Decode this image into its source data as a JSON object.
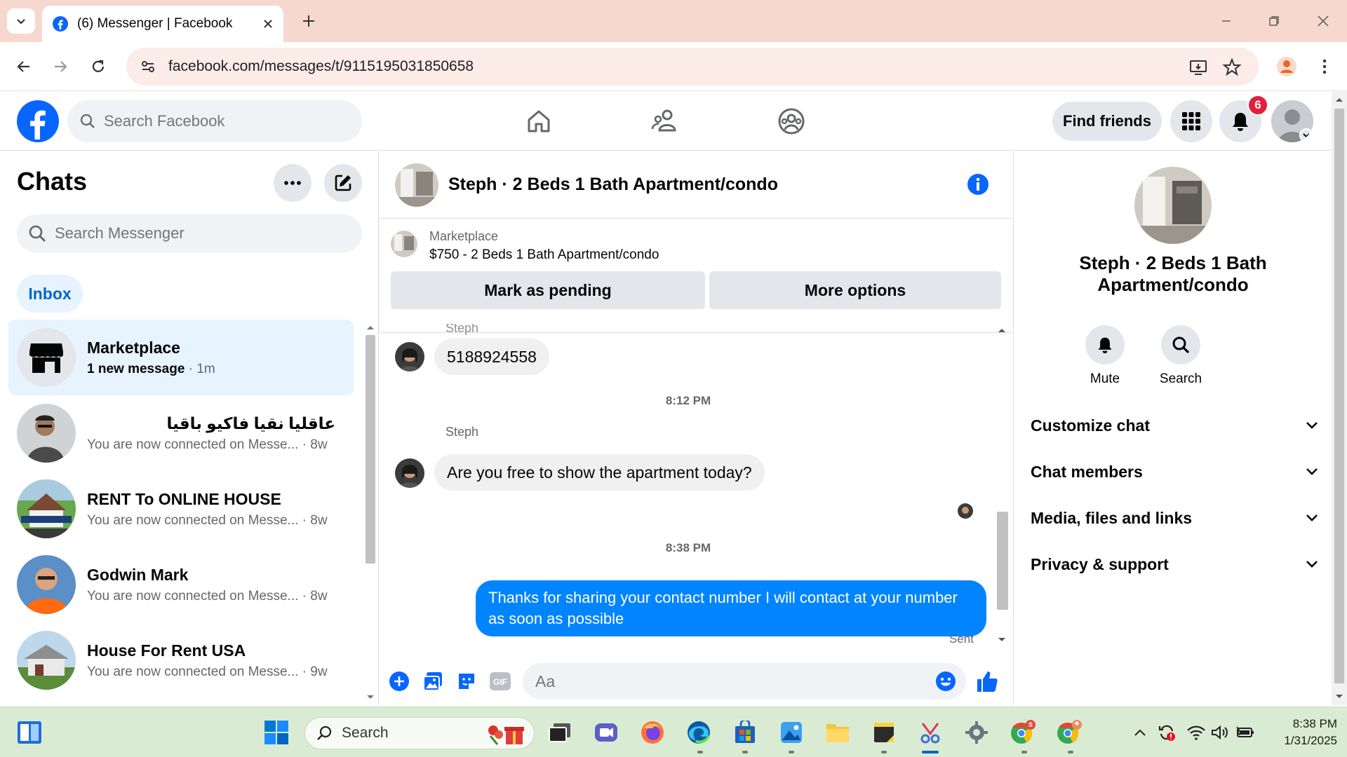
{
  "browser": {
    "tab_title": "(6) Messenger | Facebook",
    "url": "facebook.com/messages/t/9115195031850658"
  },
  "fb": {
    "search_placeholder": "Search Facebook",
    "find_friends": "Find friends",
    "notifications_count": "6"
  },
  "chats": {
    "title": "Chats",
    "search_placeholder": "Search Messenger",
    "inbox_label": "Inbox",
    "items": [
      {
        "name": "Marketplace",
        "snippet": "1 new message",
        "time": "· 1m",
        "unread": true
      },
      {
        "name": "عاقليا نقيا فاكيو باقيا",
        "snippet": "You are now connected on Messe...",
        "time": "· 8w",
        "unread": false
      },
      {
        "name": "RENT To ONLINE HOUSE",
        "snippet": "You are now connected on Messe...",
        "time": "· 8w",
        "unread": false
      },
      {
        "name": "Godwin Mark",
        "snippet": "You are now connected on Messe...",
        "time": "· 8w",
        "unread": false
      },
      {
        "name": "House For Rent USA",
        "snippet": "You are now connected on Messe...",
        "time": "· 9w",
        "unread": false
      }
    ]
  },
  "conversation": {
    "title": "Steph · 2 Beds 1 Bath Apartment/condo",
    "marketplace_label": "Marketplace",
    "listing": "$750 - 2 Beds 1 Bath Apartment/condo",
    "mark_pending": "Mark as pending",
    "more_options": "More options",
    "partial_sender": "Steph",
    "msg_phone": "5188924558",
    "time1": "8:12 PM",
    "sender": "Steph",
    "msg_question": "Are you free to show the apartment today?",
    "time2": "8:38 PM",
    "msg_reply": "Thanks for sharing your contact number I will contact at your number as soon as possible",
    "status": "Sent",
    "composer_placeholder": "Aa"
  },
  "panel": {
    "name": "Steph · 2 Beds 1 Bath Apartment/condo",
    "mute": "Mute",
    "search": "Search",
    "sections": [
      "Customize chat",
      "Chat members",
      "Media, files and links",
      "Privacy & support"
    ]
  },
  "taskbar": {
    "search_label": "Search",
    "time": "8:38 PM",
    "date": "1/31/2025"
  },
  "colors": {
    "fb_blue": "#0866ff",
    "messenger_blue": "#0084ff",
    "badge_red": "#e41e3f",
    "tab_bg": "#f7d8cf",
    "taskbar_bg": "#d9ecd3"
  }
}
